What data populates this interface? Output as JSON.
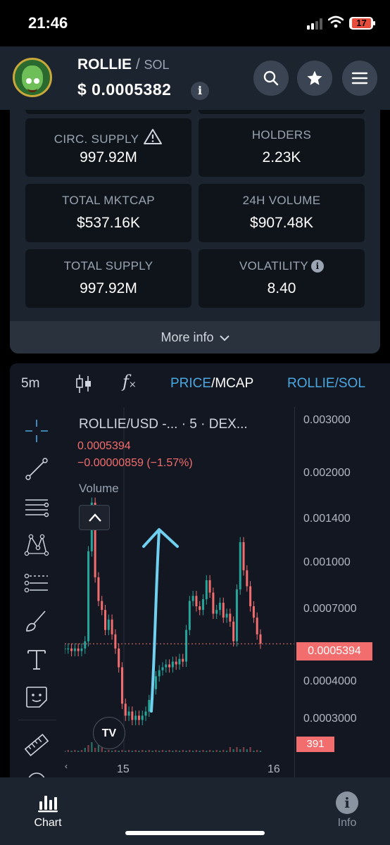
{
  "status_bar": {
    "time": "21:46",
    "battery": "17"
  },
  "header": {
    "token": "ROLLIE",
    "separator": "/",
    "quote": "SOL",
    "price": "$ 0.0005382",
    "info_glyph": "i"
  },
  "stats": {
    "cards": [
      {
        "label": "CIRC. SUPPLY",
        "value": "997.92M",
        "icon": "warning-icon"
      },
      {
        "label": "HOLDERS",
        "value": "2.23K"
      },
      {
        "label": "TOTAL MKTCAP",
        "value": "$537.16K"
      },
      {
        "label": "24H VOLUME",
        "value": "$907.48K"
      },
      {
        "label": "TOTAL SUPPLY",
        "value": "997.92M"
      },
      {
        "label": "VOLATILITY",
        "value": "8.40",
        "icon": "info-icon"
      }
    ],
    "more_info": "More info"
  },
  "chart_toolbar": {
    "timeframe": "5m",
    "price_label": "PRICE",
    "slash": "/",
    "mcap_label": "MCAP",
    "pair_selector": "ROLLIE/SOL"
  },
  "chart_legend": {
    "title": "ROLLIE/USD -...  · 5 · DEX...",
    "last_price": "0.0005394",
    "change": "−0.00000859 (−1.57%)",
    "volume_label": "Volume"
  },
  "chart_data": {
    "type": "line",
    "ylim": [
      0.00025,
      0.0032
    ],
    "y_scale": "log",
    "yticks": [
      "0.003000",
      "0.002000",
      "0.001400",
      "0.001000",
      "0.0007000",
      "0.0004000",
      "0.0003000"
    ],
    "ytick_values": [
      0.003,
      0.002,
      0.0014,
      0.001,
      0.0007,
      0.0004,
      0.0003
    ],
    "xticks": [
      "15",
      "16"
    ],
    "current_price_tag": "0.0005394",
    "volume_tag": "391",
    "series": [
      {
        "values": [
          0.00052,
          0.00052,
          0.00051,
          0.00052,
          0.00051,
          0.00052,
          0.00055,
          0.0011,
          0.0016,
          0.0009,
          0.00075,
          0.0007,
          0.0006,
          0.00065,
          0.00058,
          0.00052,
          0.00045,
          0.00034,
          0.00031,
          0.00032,
          0.0003,
          0.00031,
          0.0003,
          0.00031,
          0.00032,
          0.00035,
          0.00038,
          0.00042,
          0.00044,
          0.00045,
          0.00046,
          0.00045,
          0.00047,
          0.00046,
          0.00048,
          0.00047,
          0.0006,
          0.00075,
          0.00078,
          0.00072,
          0.0007,
          0.00076,
          0.00088,
          0.0008,
          0.00068,
          0.0007,
          0.00074,
          0.00066,
          0.00068,
          0.00064,
          0.00055,
          0.00082,
          0.00118,
          0.00095,
          0.00084,
          0.00072,
          0.00066,
          0.00058,
          0.00054
        ]
      }
    ]
  },
  "bottom_tabs": [
    {
      "label": "Chart",
      "icon": "chart-icon",
      "active": true
    },
    {
      "label": "Info",
      "icon": "info-icon",
      "active": false
    }
  ],
  "colors": {
    "background": "#131722",
    "panel": "#1c2430",
    "accent": "#4aa8e0",
    "down": "#f26d6d",
    "up": "#26a69a",
    "arrow": "#6fd0f0"
  }
}
